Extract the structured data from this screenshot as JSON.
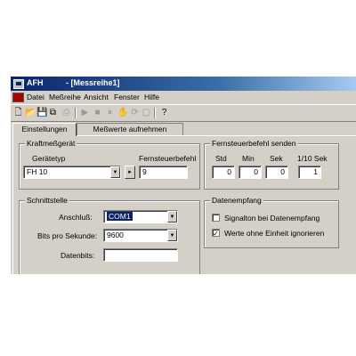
{
  "window": {
    "app_name": "AFH",
    "doc_title": "- [Messreihe1]"
  },
  "menu": [
    "Datei",
    "Meßreihe",
    "Ansicht",
    "Fenster",
    "Hilfe"
  ],
  "toolbar": {
    "icons": [
      "new-icon",
      "open-icon",
      "save-icon",
      "copy-icon",
      "print-icon",
      "play-icon",
      "stop-icon",
      "pause-icon",
      "record-icon",
      "refresh-icon",
      "help-icon"
    ]
  },
  "tabs": [
    {
      "label": "Einstellungen",
      "active": true
    },
    {
      "label": "Meßwerte aufnehmen",
      "active": false
    }
  ],
  "kraftmessgeraet": {
    "title": "Kraftmeßgerät",
    "geraetetyp_label": "Gerätetyp",
    "geraetetyp_value": "FH 10",
    "fernsteuerbefehl_label": "Fernsteuerbefehl",
    "fernsteuerbefehl_value": "9"
  },
  "fernsteuer_senden": {
    "title": "Fernsteuerbefehl senden",
    "columns": [
      {
        "label": "Std",
        "value": "0"
      },
      {
        "label": "Min",
        "value": "0"
      },
      {
        "label": "Sek",
        "value": "0"
      },
      {
        "label": "1/10 Sek",
        "value": "1"
      }
    ]
  },
  "schnittstelle": {
    "title": "Schnittstelle",
    "anschluss_label": "Anschluß:",
    "anschluss_value": "COM1",
    "bits_label": "Bits pro Sekunde:",
    "bits_value": "9600",
    "next_label": "Datenbits:"
  },
  "datenempfang": {
    "title": "Datenempfang",
    "options": [
      {
        "label": "Signalton bei Datenempfang",
        "checked": false
      },
      {
        "label": "Werte ohne Einheit ignorieren",
        "checked": true
      }
    ]
  }
}
